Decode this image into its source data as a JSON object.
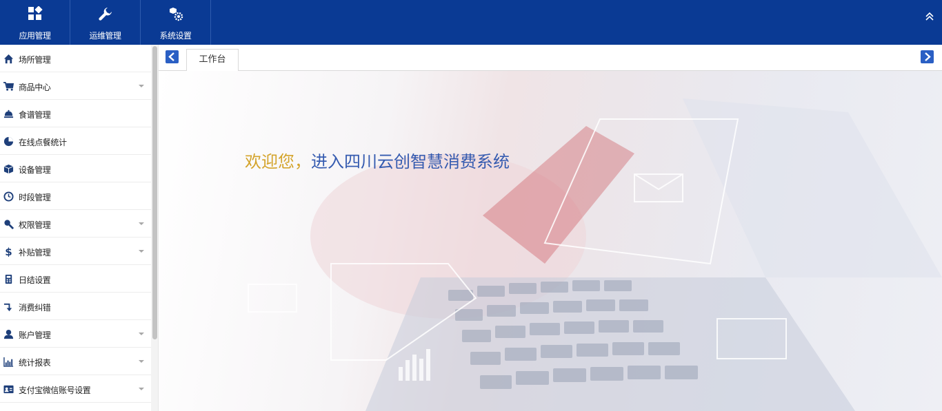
{
  "top_nav": {
    "items": [
      {
        "label": "应用管理",
        "icon": "grid-icon"
      },
      {
        "label": "运维管理",
        "icon": "wrench-icon"
      },
      {
        "label": "系统设置",
        "icon": "cubes-gear-icon"
      }
    ],
    "collapse_icon": "double-chevron-up-icon"
  },
  "sidebar": {
    "items": [
      {
        "label": "场所管理",
        "icon": "home-icon",
        "expandable": false
      },
      {
        "label": "商品中心",
        "icon": "cart-icon",
        "expandable": true
      },
      {
        "label": "食谱管理",
        "icon": "cloche-icon",
        "expandable": false
      },
      {
        "label": "在线点餐统计",
        "icon": "pie-chart-icon",
        "expandable": false
      },
      {
        "label": "设备管理",
        "icon": "cube-icon",
        "expandable": false
      },
      {
        "label": "时段管理",
        "icon": "clock-icon",
        "expandable": false
      },
      {
        "label": "权限管理",
        "icon": "key-icon",
        "expandable": true
      },
      {
        "label": "补贴管理",
        "icon": "dollar-icon",
        "expandable": true
      },
      {
        "label": "日结设置",
        "icon": "calculator-icon",
        "expandable": false
      },
      {
        "label": "消费纠错",
        "icon": "return-arrow-icon",
        "expandable": false
      },
      {
        "label": "账户管理",
        "icon": "user-icon",
        "expandable": true
      },
      {
        "label": "统计报表",
        "icon": "bar-chart-icon",
        "expandable": true
      },
      {
        "label": "支付宝微信账号设置",
        "icon": "id-card-icon",
        "expandable": true
      }
    ]
  },
  "tabs": {
    "active": "工作台",
    "prev_icon": "chevron-left-icon",
    "next_icon": "chevron-right-icon"
  },
  "main": {
    "welcome_prefix": "欢迎您，",
    "welcome_main": "进入四川云创智慧消费系统"
  },
  "colors": {
    "topbar": "#0a3a94",
    "accent_blue": "#2a5fc4",
    "welcome_gold": "#d4a42c",
    "welcome_blue": "#355bb0"
  }
}
